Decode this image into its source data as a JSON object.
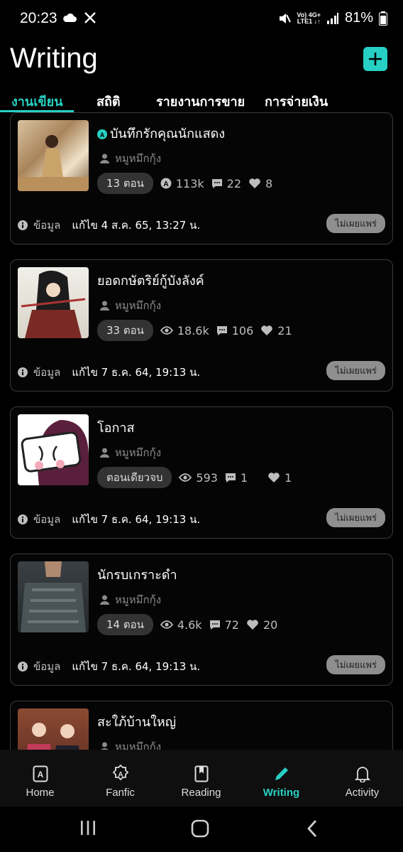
{
  "status_bar": {
    "time": "20:23",
    "battery": "81%",
    "network_top": "Vo) 4G+",
    "network_bottom": "LTE1 ↓↑"
  },
  "header": {
    "title": "Writing"
  },
  "tabs": [
    {
      "label": "งานเขียน",
      "active": true
    },
    {
      "label": "สถิติ",
      "active": false
    },
    {
      "label": "รายงานการขาย",
      "active": false
    },
    {
      "label": "การจ่ายเงิน",
      "active": false
    }
  ],
  "works": [
    {
      "title": "บันทึกรักคุณนักแสดง",
      "author": "หมูหมึกกุ้ง",
      "chapters": "13 ตอน",
      "views": "113k",
      "comments": "22",
      "likes": "8",
      "info_label": "ข้อมูล",
      "edited": "แก้ไข 4 ส.ค. 65, 13:27 น.",
      "status": "ไม่เผยแพร่",
      "fanfic": true
    },
    {
      "title": "ยอดกษัตริย์กู้บังลังค์",
      "author": "หมูหมึกกุ้ง",
      "chapters": "33 ตอน",
      "views": "18.6k",
      "comments": "106",
      "likes": "21",
      "info_label": "ข้อมูล",
      "edited": "แก้ไข 7 ธ.ค. 64, 19:13 น.",
      "status": "ไม่เผยแพร่",
      "fanfic": false
    },
    {
      "title": "โอกาส",
      "author": "หมูหมึกกุ้ง",
      "chapters": "ตอนเดียวจบ",
      "views": "593",
      "comments": "1",
      "likes": "1",
      "info_label": "ข้อมูล",
      "edited": "แก้ไข 7 ธ.ค. 64, 19:13 น.",
      "status": "ไม่เผยแพร่",
      "fanfic": false
    },
    {
      "title": "นักรบเกราะดำ",
      "author": "หมูหมึกกุ้ง",
      "chapters": "14 ตอน",
      "views": "4.6k",
      "comments": "72",
      "likes": "20",
      "info_label": "ข้อมูล",
      "edited": "แก้ไข 7 ธ.ค. 64, 19:13 น.",
      "status": "ไม่เผยแพร่",
      "fanfic": false
    },
    {
      "title": "สะใภ้บ้านใหญ่",
      "author": "หมูหมึกกุ้ง",
      "chapters": "",
      "views": "",
      "comments": "",
      "likes": "",
      "info_label": "",
      "edited": "",
      "status": "",
      "fanfic": false
    }
  ],
  "bottom_nav": [
    {
      "label": "Home",
      "icon": "home-book-icon",
      "active": false
    },
    {
      "label": "Fanfic",
      "icon": "fanfic-badge-icon",
      "active": false
    },
    {
      "label": "Reading",
      "icon": "bookmark-book-icon",
      "active": false
    },
    {
      "label": "Writing",
      "icon": "pencil-icon",
      "active": true
    },
    {
      "label": "Activity",
      "icon": "bell-icon",
      "active": false
    }
  ],
  "colors": {
    "accent": "#26d0c4",
    "background": "#000000",
    "card_border": "#3a3a3a",
    "badge_bg": "#8f8f8f"
  }
}
